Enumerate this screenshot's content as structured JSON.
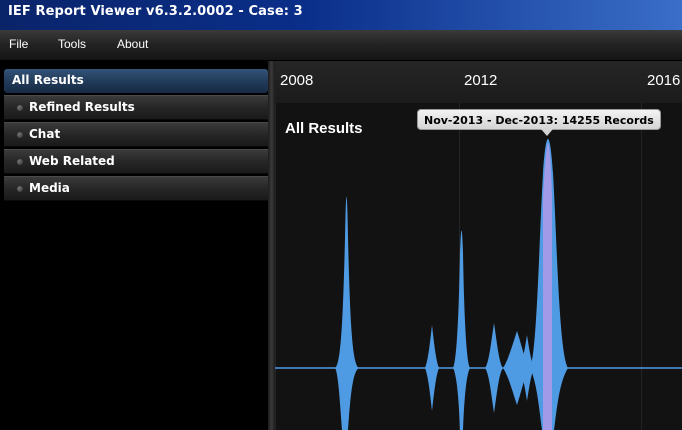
{
  "window": {
    "title": "IEF Report Viewer v6.3.2.0002 - Case: 3"
  },
  "menu": {
    "items": [
      "File",
      "Tools",
      "About"
    ]
  },
  "sidebar": {
    "header": "All Results",
    "items": [
      {
        "label": "Refined Results"
      },
      {
        "label": "Chat"
      },
      {
        "label": "Web Related"
      },
      {
        "label": "Media"
      }
    ]
  },
  "timeline": {
    "years": [
      "2008",
      "2012",
      "2016"
    ],
    "title": "All Results",
    "tooltip": "Nov-2013 - Dec-2013: 14255 Records",
    "colors": {
      "series": "#4f9be3",
      "highlight": "#a89ae8",
      "baseline": "#4f9be3"
    }
  }
}
